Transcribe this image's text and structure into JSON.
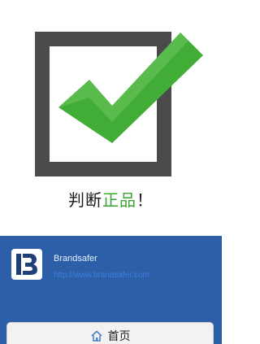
{
  "result": {
    "prefix": "判断",
    "highlight": "正品",
    "suffix": "！"
  },
  "brand": {
    "name": "Brandsafer",
    "url": "http://www.brandsafer.com",
    "logo_letter": "B"
  },
  "home_button": {
    "label": "首页",
    "icon": "home-icon"
  },
  "colors": {
    "check_green": "#3aa52f",
    "box_gray": "#4a4a4a",
    "panel_blue": "#2c5fa8",
    "link_blue": "#3f7ee0"
  }
}
